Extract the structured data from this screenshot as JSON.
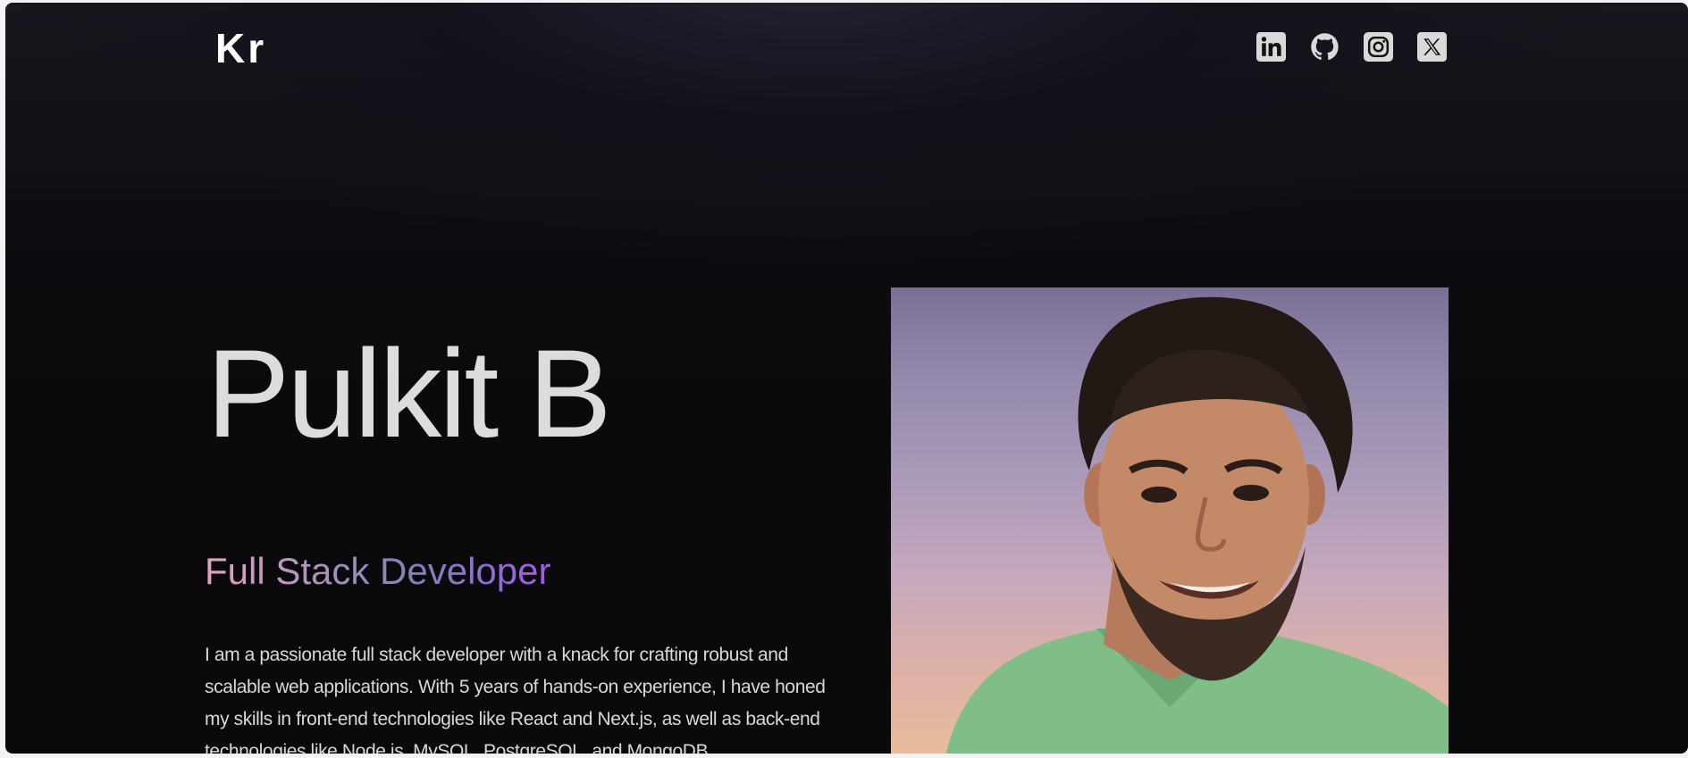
{
  "header": {
    "logo": "Kr",
    "social_icons": [
      "linkedin-icon",
      "github-icon",
      "instagram-icon",
      "x-icon"
    ]
  },
  "hero": {
    "name": "Pulkit B",
    "role": "Full Stack Developer",
    "bio": "I am a passionate full stack developer with a knack for crafting robust and scalable web applications. With 5 years of hands-on experience, I have honed my skills in front-end technologies like React and Next.js, as well as back-end technologies like Node.js, MySQL, PostgreSQL, and MongoDB."
  },
  "colors": {
    "background": "#0a0a0b",
    "name_text": "#dcdcdc",
    "role_gradient_start": "#e4a3c7",
    "role_gradient_end": "#a05ae8",
    "icon": "#d9d9d9"
  }
}
